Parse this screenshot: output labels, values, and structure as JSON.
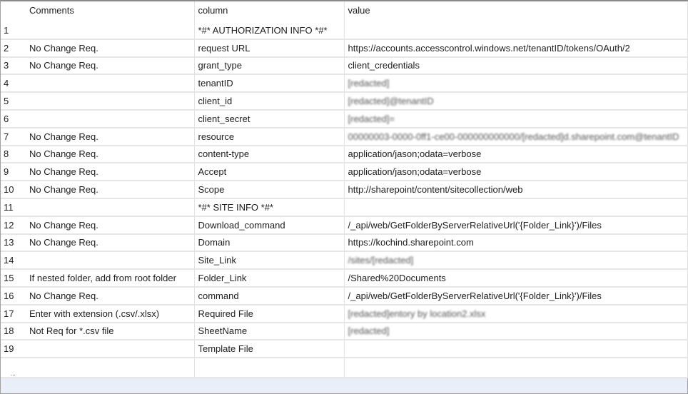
{
  "grid": {
    "columns": [
      "",
      "Comments",
      "column",
      "value"
    ],
    "rows": [
      {
        "n": "1",
        "comment": "",
        "column": "*#* AUTHORIZATION INFO *#*",
        "value": ""
      },
      {
        "n": "2",
        "comment": "No Change Req.",
        "column": "request URL",
        "value": "https://accounts.accesscontrol.windows.net/tenantID/tokens/OAuth/2"
      },
      {
        "n": "3",
        "comment": "No Change Req.",
        "column": "grant_type",
        "value": "client_credentials"
      },
      {
        "n": "4",
        "comment": "",
        "column": "tenantID",
        "value": "[redacted]"
      },
      {
        "n": "5",
        "comment": "",
        "column": "client_id",
        "value": "[redacted]@tenantID"
      },
      {
        "n": "6",
        "comment": "",
        "column": "client_secret",
        "value": "[redacted]="
      },
      {
        "n": "7",
        "comment": "No Change Req.",
        "column": "resource",
        "value": "00000003-0000-0ff1-ce00-000000000000/[redacted]d.sharepoint.com@tenantID"
      },
      {
        "n": "8",
        "comment": "No Change Req.",
        "column": "content-type",
        "value": "application/jason;odata=verbose"
      },
      {
        "n": "9",
        "comment": "No Change Req.",
        "column": "Accept",
        "value": "application/jason;odata=verbose"
      },
      {
        "n": "10",
        "comment": "No Change Req.",
        "column": "Scope",
        "value": "http://sharepoint/content/sitecollection/web"
      },
      {
        "n": "11",
        "comment": "",
        "column": "*#* SITE INFO *#*",
        "value": ""
      },
      {
        "n": "12",
        "comment": "No Change Req.",
        "column": "Download_command",
        "value": "/_api/web/GetFolderByServerRelativeUrl('{Folder_Link}')/Files"
      },
      {
        "n": "13",
        "comment": "No Change Req.",
        "column": "Domain",
        "value": "https://kochind.sharepoint.com"
      },
      {
        "n": "14",
        "comment": "",
        "column": "Site_Link",
        "value": "/sites/[redacted]"
      },
      {
        "n": "15",
        "comment": "If nested folder, add from root folder",
        "column": "Folder_Link",
        "value": "/Shared%20Documents"
      },
      {
        "n": "16",
        "comment": "No Change Req.",
        "column": "command",
        "value": "/_api/web/GetFolderByServerRelativeUrl('{Folder_Link}')/Files"
      },
      {
        "n": "17",
        "comment": "Enter with extension (.csv/.xlsx)",
        "column": "Required File",
        "value": "[redacted]entory by location2.xlsx"
      },
      {
        "n": "18",
        "comment": "Not Req for *.csv file",
        "column": "SheetName",
        "value": "[redacted]"
      },
      {
        "n": "19",
        "comment": "",
        "column": "Template File",
        "value": ""
      }
    ],
    "new_row_marker": "..."
  }
}
